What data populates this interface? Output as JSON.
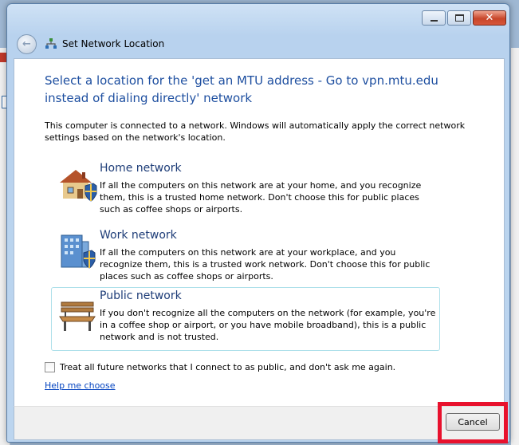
{
  "window": {
    "title": "Set Network Location"
  },
  "heading": "Select a location for the 'get an MTU address - Go to vpn.mtu.edu instead of dialing directly' network",
  "intro": "This computer is connected to a network. Windows will automatically apply the correct network settings based on the network's location.",
  "options": [
    {
      "title": "Home network",
      "description": "If all the computers on this network are at your home, and you recognize them, this is a trusted home network.  Don't choose this for public places such as coffee shops or airports.",
      "icon": "house-shield-icon"
    },
    {
      "title": "Work network",
      "description": "If all the computers on this network are at your workplace, and you recognize them, this is a trusted work network.  Don't choose this for public places such as coffee shops or airports.",
      "icon": "building-shield-icon"
    },
    {
      "title": "Public network",
      "description": "If you don't recognize all the computers on the network (for example, you're in a coffee shop or airport, or you have mobile broadband), this is a public network and is not trusted.",
      "icon": "park-bench-icon",
      "selected": true
    }
  ],
  "checkbox": {
    "label": "Treat all future networks that I connect to as public, and don't ask me again.",
    "checked": false
  },
  "help_link": "Help me choose",
  "footer": {
    "cancel_label": "Cancel"
  },
  "colors": {
    "heading": "#1e4fa0",
    "link": "#0645c0",
    "highlight": "#e8112d",
    "selected_border": "#aee0ea"
  }
}
